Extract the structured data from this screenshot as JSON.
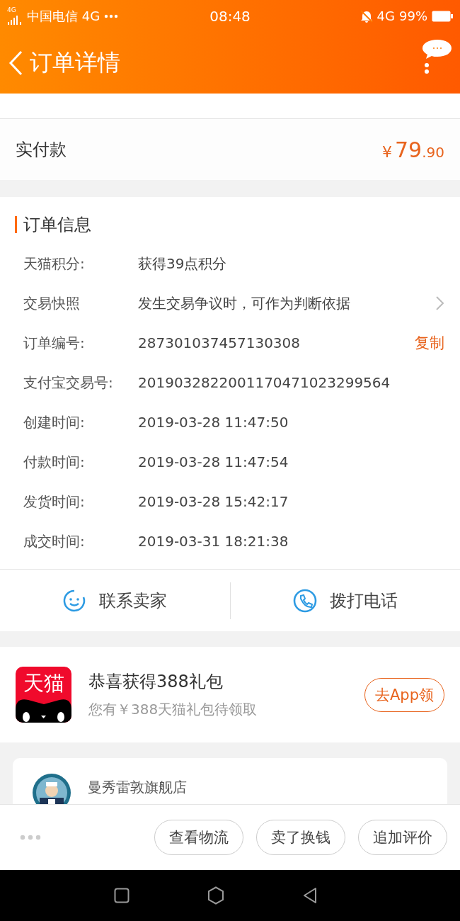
{
  "status_bar": {
    "signal_label": "4G",
    "carrier": "中国电信 4G",
    "time": "08:48",
    "network": "4G",
    "battery": "99%"
  },
  "header": {
    "title": "订单详情"
  },
  "price": {
    "paid_label": "实付款",
    "paid_currency": "¥",
    "paid_integer": "79",
    "paid_decimal": ".90"
  },
  "order_info": {
    "title": "订单信息",
    "rows": [
      {
        "label": "天猫积分:",
        "value": "获得39点积分",
        "kind": "plain"
      },
      {
        "label": "交易快照",
        "value": "发生交易争议时，可作为判断依据",
        "kind": "link"
      },
      {
        "label": "订单编号:",
        "value": "287301037457130308",
        "kind": "copy",
        "action": "复制"
      },
      {
        "label": "支付宝交易号:",
        "value": "2019032822001170471023299564",
        "kind": "plain"
      },
      {
        "label": "创建时间:",
        "value": "2019-03-28 11:47:50",
        "kind": "plain"
      },
      {
        "label": "付款时间:",
        "value": "2019-03-28 11:47:54",
        "kind": "plain"
      },
      {
        "label": "发货时间:",
        "value": "2019-03-28 15:42:17",
        "kind": "plain"
      },
      {
        "label": "成交时间:",
        "value": "2019-03-31 18:21:38",
        "kind": "plain"
      }
    ]
  },
  "contact": [
    {
      "label": "联系卖家",
      "kind": "chat"
    },
    {
      "label": "拨打电话",
      "kind": "phone"
    }
  ],
  "promo": {
    "logo_text": "天猫",
    "title": "恭喜获得388礼包",
    "subtitle": "您有￥388天猫礼包待领取",
    "button": "去App领"
  },
  "shop": {
    "name": "曼秀雷敦旗舰店"
  },
  "actions": [
    "查看物流",
    "卖了换钱",
    "追加评价"
  ]
}
